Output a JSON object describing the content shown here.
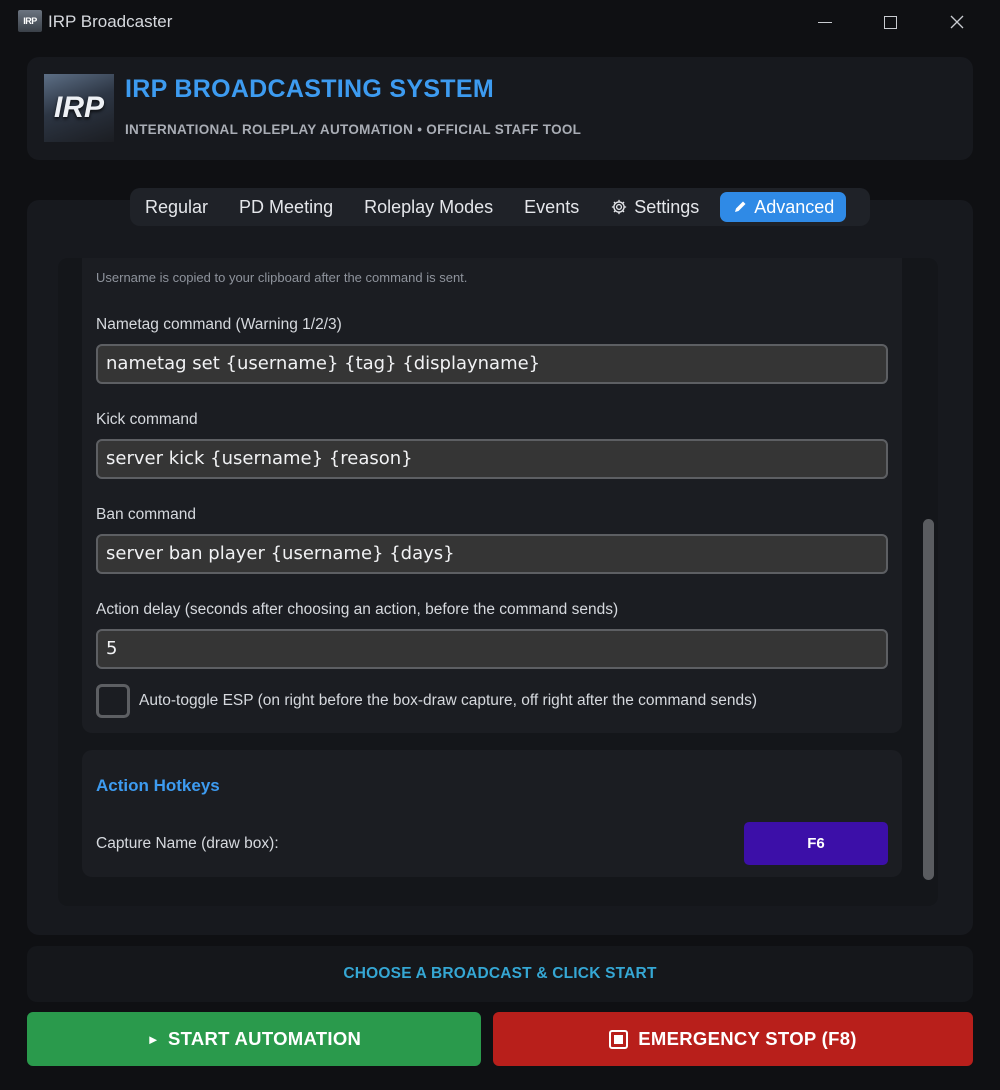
{
  "window": {
    "icon_text": "IRP",
    "title": "IRP Broadcaster"
  },
  "header": {
    "logo_text": "IRP",
    "title": "IRP BROADCASTING SYSTEM",
    "subtitle": "INTERNATIONAL ROLEPLAY AUTOMATION • OFFICIAL STAFF TOOL"
  },
  "tabs": [
    {
      "label": "Regular"
    },
    {
      "label": "PD Meeting"
    },
    {
      "label": "Roleplay Modes"
    },
    {
      "label": "Events"
    },
    {
      "label": "Settings",
      "icon": "gear-icon"
    },
    {
      "label": "Advanced",
      "icon": "pen-icon",
      "active": true
    }
  ],
  "commands": {
    "hint": "Username is copied to your clipboard after the command is sent.",
    "nametag_label": "Nametag command (Warning 1/2/3)",
    "nametag_value": "nametag set {username} {tag} {displayname}",
    "kick_label": "Kick command",
    "kick_value": "server kick {username} {reason}",
    "ban_label": "Ban command",
    "ban_value": "server ban player {username} {days}",
    "delay_label": "Action delay (seconds after choosing an action, before the command sends)",
    "delay_value": "5",
    "esp_label": "Auto-toggle ESP (on right before the box-draw capture, off right after the command sends)",
    "esp_checked": false
  },
  "hotkeys": {
    "title": "Action Hotkeys",
    "capture_label": "Capture Name (draw box):",
    "capture_key": "F6"
  },
  "status": {
    "text": "CHOOSE A BROADCAST & CLICK START"
  },
  "actions": {
    "start_icon": "►",
    "start_label": "START AUTOMATION",
    "stop_label": "EMERGENCY STOP (F8)"
  },
  "colors": {
    "accent": "#2f8ae6",
    "title_blue": "#3d9bf0",
    "start_green": "#2a9a4c",
    "stop_red": "#b81f1b",
    "hotkey_purple": "#3c0fa8",
    "status_cyan": "#35a7d4"
  }
}
